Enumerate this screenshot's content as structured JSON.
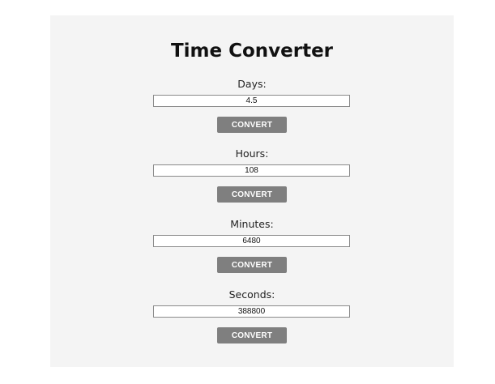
{
  "title": "Time Converter",
  "converters": [
    {
      "label": "Days:",
      "value": "4.5",
      "button_label": "CONVERT"
    },
    {
      "label": "Hours:",
      "value": "108",
      "button_label": "CONVERT"
    },
    {
      "label": "Minutes:",
      "value": "6480",
      "button_label": "CONVERT"
    },
    {
      "label": "Seconds:",
      "value": "388800",
      "button_label": "CONVERT"
    }
  ],
  "colors": {
    "card_background": "#f4f4f4",
    "button_background": "#7f7f7f",
    "button_text": "#ffffff"
  }
}
